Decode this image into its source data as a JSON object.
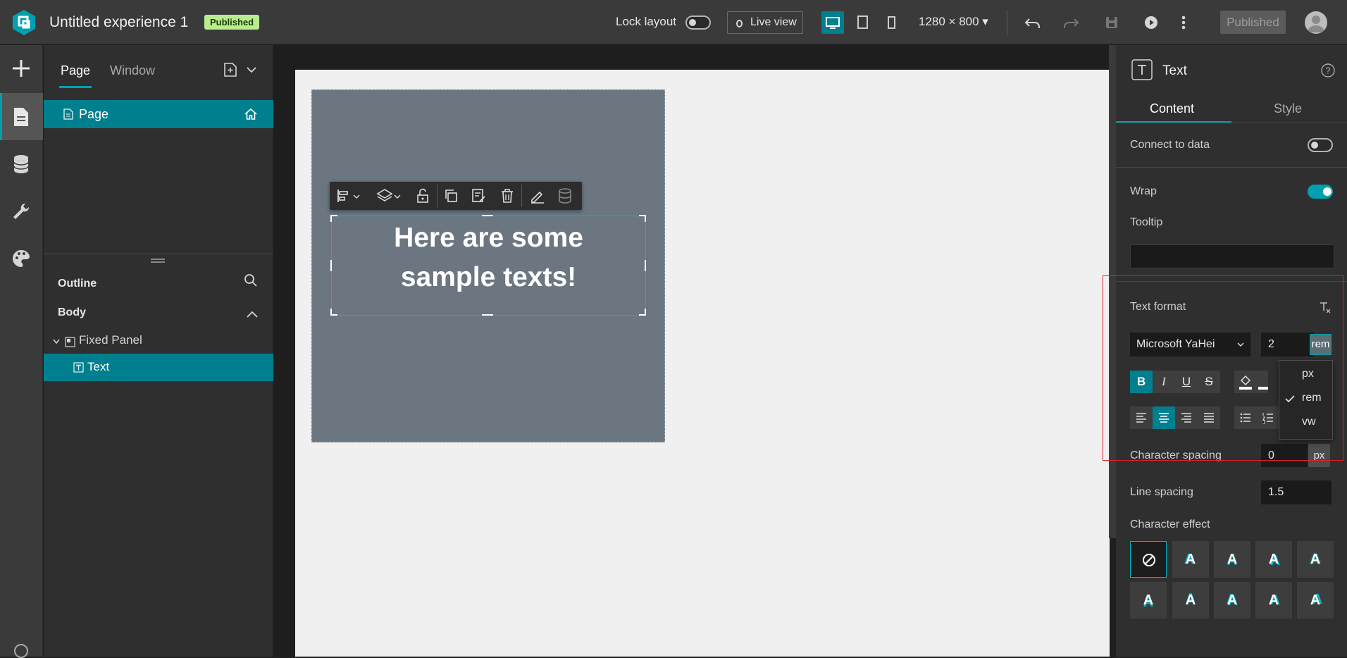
{
  "topbar": {
    "app_title": "Untitled experience 1",
    "status_badge": "Published",
    "lock_layout_label": "Lock layout",
    "live_view_label": "Live view",
    "resolution": "1280 × 800",
    "publish_button": "Published"
  },
  "page_panel": {
    "tabs": [
      "Page",
      "Window"
    ],
    "pages": [
      {
        "label": "Page"
      }
    ],
    "outline_title": "Outline",
    "body_label": "Body",
    "tree": [
      {
        "label": "Fixed Panel"
      },
      {
        "label": "Text"
      }
    ]
  },
  "canvas": {
    "sample_text_line1": "Here are some",
    "sample_text_line2": "sample texts!"
  },
  "props": {
    "title": "Text",
    "tabs": [
      "Content",
      "Style"
    ],
    "connect_to_data": "Connect to data",
    "wrap": "Wrap",
    "tooltip": "Tooltip",
    "tooltip_value": "",
    "text_format": "Text format",
    "font_family": "Microsoft YaHei",
    "font_size": "2",
    "font_unit": "rem",
    "format_buttons": [
      "B",
      "I",
      "U",
      "S"
    ],
    "unit_options": [
      "px",
      "rem",
      "vw"
    ],
    "selected_unit": "rem",
    "character_spacing": "Character spacing",
    "character_spacing_value": "0",
    "character_spacing_unit": "px",
    "line_spacing": "Line spacing",
    "line_spacing_value": "1.5",
    "character_effect": "Character effect",
    "effect_glyph": "A"
  },
  "colors": {
    "accent": "#00a0b0",
    "selection": "#007f8f",
    "badge": "#b9ec8f",
    "highlight_box": "#e0202a"
  }
}
